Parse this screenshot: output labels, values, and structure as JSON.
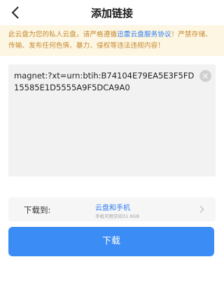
{
  "header": {
    "title": "添加链接",
    "back_icon": "back-arrow-icon"
  },
  "notice": {
    "text_before": "此云盘为您的私人云盘，请严格遵循",
    "link_text": "迅雷云盘服务协议",
    "text_after": "！严禁存储、传输、发布任何色情、暴力、侵权等违法违规内容！",
    "text_color": "#c5892e",
    "link_color": "#2d7cf0",
    "background": "#fdf6e3"
  },
  "link_input": {
    "value": "magnet:?xt=urn:btih:B74104E79EA5E3F5FD15585E1D5555A9F5DCA9A0",
    "clear_icon": "clear-icon"
  },
  "destination": {
    "label": "下载到:",
    "value": "云盘和手机",
    "subtext": "手机可用空间31.9GB",
    "chevron_icon": "chevron-right-icon"
  },
  "download_button": {
    "label": "下载",
    "color": "#3b8df5"
  }
}
